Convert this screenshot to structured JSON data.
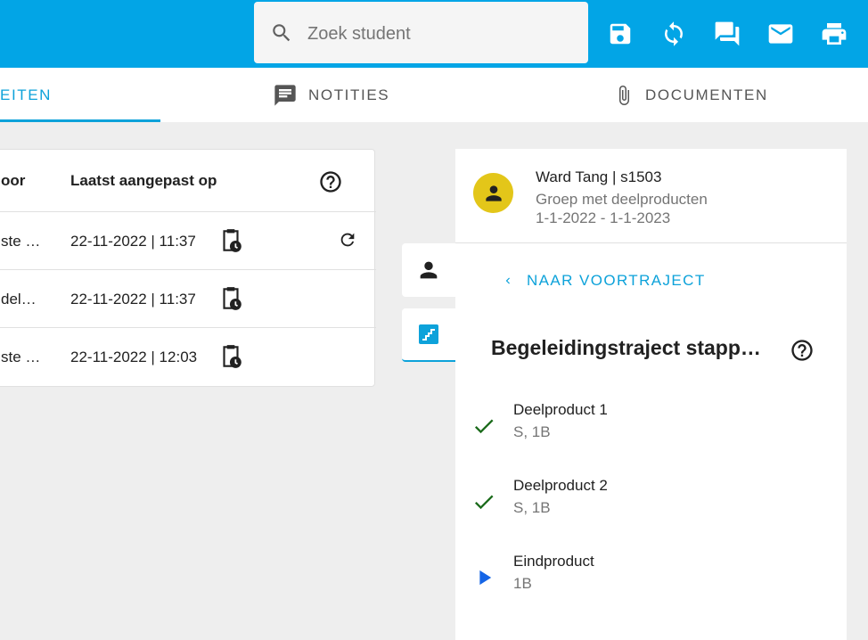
{
  "search": {
    "placeholder": "Zoek student"
  },
  "toolbar": {
    "save_icon": "save-icon",
    "sync_icon": "sync-icon",
    "chat_icon": "chat-icon",
    "mail_icon": "mail-icon",
    "print_icon": "print-icon"
  },
  "tabs": [
    {
      "label": "EITEN",
      "active": true
    },
    {
      "label": "NOTITIES",
      "icon": "notes-icon"
    },
    {
      "label": "DOCUMENTEN",
      "icon": "paperclip-icon"
    }
  ],
  "table": {
    "headers": [
      "oor",
      "Laatst aangepast op"
    ],
    "rows": [
      {
        "col1": "ste …",
        "modified": "22-11-2022 | 11:37",
        "has_refresh": true
      },
      {
        "col1": "del…",
        "modified": "22-11-2022 | 11:37",
        "has_refresh": false
      },
      {
        "col1": "ste …",
        "modified": "22-11-2022 | 12:03",
        "has_refresh": false
      }
    ]
  },
  "student": {
    "name": "Ward Tang | s1503",
    "group": "Groep met deelproducten",
    "period": "1-1-2022 - 1-1-2023"
  },
  "panel": {
    "back_label": "NAAR VOORTRAJECT",
    "title": "Begeleidingstraject stapp…",
    "steps": [
      {
        "title": "Deelproduct 1",
        "sub": "S, 1B",
        "status": "done"
      },
      {
        "title": "Deelproduct 2",
        "sub": "S, 1B",
        "status": "done"
      },
      {
        "title": "Eindproduct",
        "sub": "1B",
        "status": "current"
      }
    ]
  },
  "colors": {
    "primary": "#02a5e6",
    "accent": "#0da2da",
    "avatar": "#e3c619",
    "check": "#1b6b1b",
    "play": "#1565e6"
  }
}
